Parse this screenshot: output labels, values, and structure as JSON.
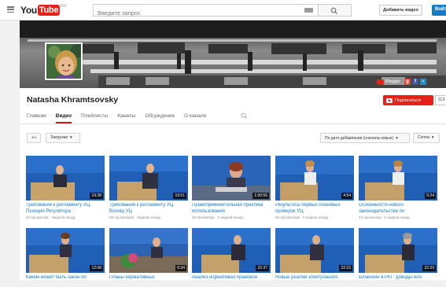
{
  "topbar": {
    "logo_you": "You",
    "logo_tube": "Tube",
    "logo_region": "RU",
    "search_placeholder": "Введите запрос",
    "add_video": "Добавить видео",
    "signin": "Войти"
  },
  "banner": {
    "link_blogger": "Blogger"
  },
  "channel": {
    "name": "Natasha Khramtsovsky",
    "subscribe_label": "Подписаться",
    "subscriber_count": "113",
    "tabs": [
      {
        "label": "Главная"
      },
      {
        "label": "Видео"
      },
      {
        "label": "Плейлисты"
      },
      {
        "label": "Каналы"
      },
      {
        "label": "Обсуждение"
      },
      {
        "label": "О канале"
      }
    ]
  },
  "toolbar": {
    "back": "↤",
    "uploads": "Загрузки",
    "sort": "По дате добавления (сначала новые)",
    "view": "Сетка"
  },
  "videos": [
    {
      "title": "Требования к регламенту УЦ. Позиция Регулятора",
      "meta": "24 просмотра · Неделю назад",
      "duration": "19:38"
    },
    {
      "title": "Требования к регламенту УЦ. Взгляд УЦ",
      "meta": "29 просмотров · Неделю назад",
      "duration": "19:51"
    },
    {
      "title": "Правоприменительная практика использования",
      "meta": "33 просмотра · 2 недели назад",
      "duration": "1:00:55"
    },
    {
      "title": "Результаты первых плановых проверок УЦ",
      "meta": "26 просмотров · 2 недели назад",
      "duration": "4:54"
    },
    {
      "title": "Особенности нового законодательства по",
      "meta": "23 просмотра · 2 недели назад",
      "duration": "5:24"
    },
    {
      "title": "Каким может быть закон об",
      "meta": "",
      "duration": "12:08"
    },
    {
      "title": "Планы нормативных",
      "meta": "",
      "duration": "6:34"
    },
    {
      "title": "Анализ нормативно правовой",
      "meta": "",
      "duration": "22:37"
    },
    {
      "title": "Новые реалии электронного",
      "meta": "",
      "duration": "22:22"
    },
    {
      "title": "Блокчейн в РКГ: доводы или",
      "meta": "",
      "duration": "22:33"
    }
  ],
  "colors": {
    "brand_red": "#e62117",
    "link_blue": "#167ac6",
    "tab_underline": "#cc181e"
  }
}
